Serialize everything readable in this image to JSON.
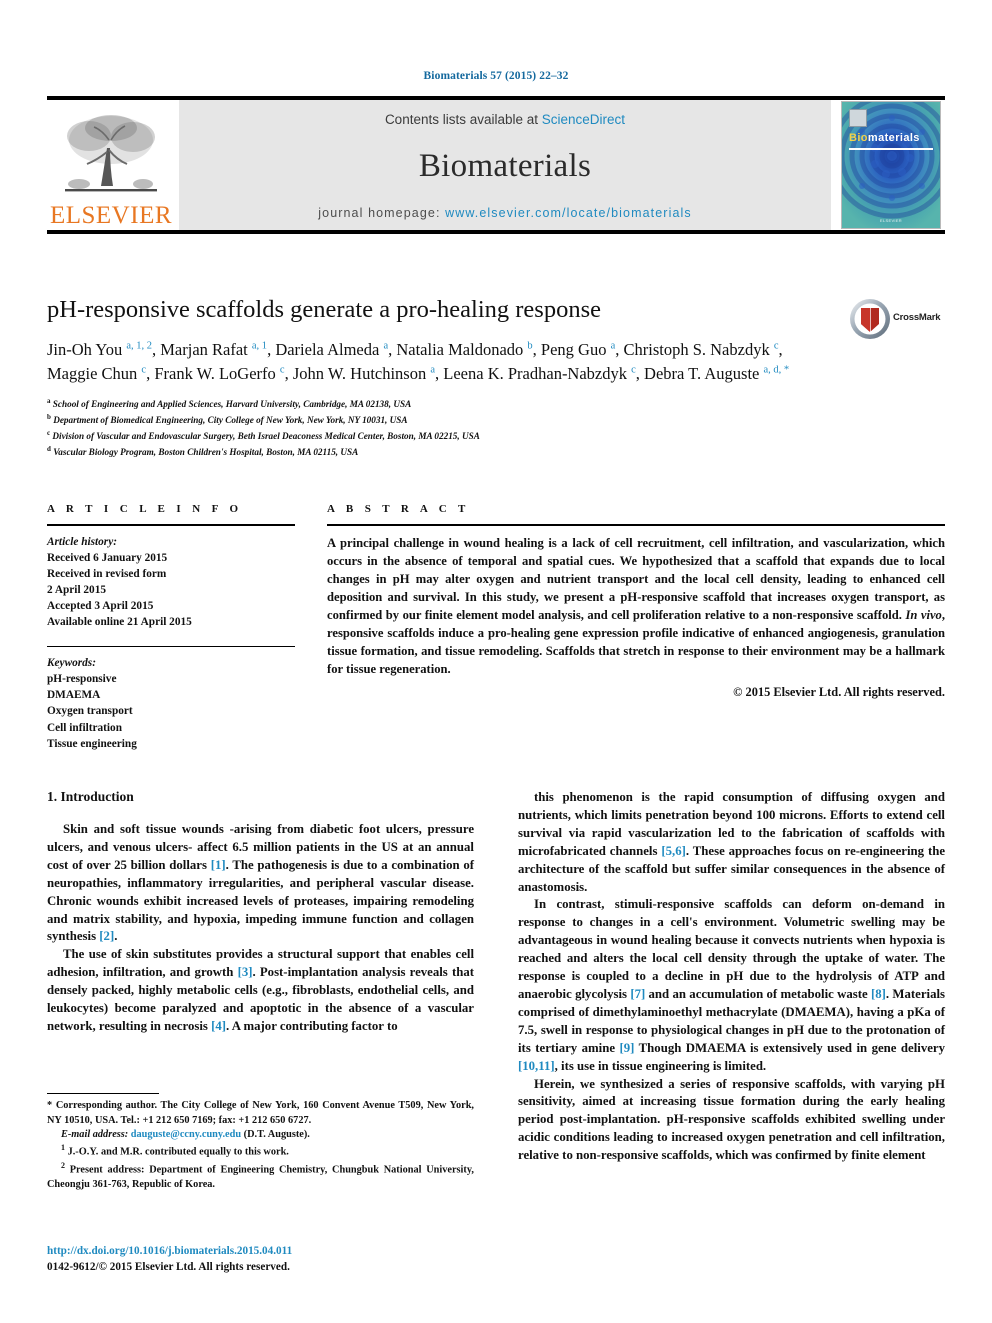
{
  "running_head": "Biomaterials 57 (2015) 22–32",
  "masthead": {
    "publisher_logo_text": "ELSEVIER",
    "contents_prefix": "Contents lists available at ",
    "contents_link": "ScienceDirect",
    "journal_name": "Biomaterials",
    "homepage_prefix": "journal homepage: ",
    "homepage_url": "www.elsevier.com/locate/biomaterials",
    "cover": {
      "title_bio": "Bio",
      "title_rest": "materials",
      "footer": "ELSEVIER"
    }
  },
  "article": {
    "title": "pH-responsive scaffolds generate a pro-healing response",
    "crossmark_label": "CrossMark",
    "authors_html": "Jin-Oh You <sup>a, 1, 2</sup>, Marjan Rafat <sup>a, 1</sup>, Dariela Almeda <sup>a</sup>, Natalia Maldonado <sup>b</sup>, Peng Guo <sup>a</sup>, Christoph S. Nabzdyk <sup>c</sup>, Maggie Chun <sup>c</sup>, Frank W. LoGerfo <sup>c</sup>, John W. Hutchinson <sup>a</sup>, Leena K. Pradhan-Nabzdyk <sup>c</sup>, Debra T. Auguste <sup>a, d, *</sup>",
    "affiliations": [
      {
        "mark": "a",
        "text": "School of Engineering and Applied Sciences, Harvard University, Cambridge, MA 02138, USA"
      },
      {
        "mark": "b",
        "text": "Department of Biomedical Engineering, City College of New York, New York, NY 10031, USA"
      },
      {
        "mark": "c",
        "text": "Division of Vascular and Endovascular Surgery, Beth Israel Deaconess Medical Center, Boston, MA 02215, USA"
      },
      {
        "mark": "d",
        "text": "Vascular Biology Program, Boston Children's Hospital, Boston, MA 02115, USA"
      }
    ]
  },
  "article_info": {
    "heading": "A R T I C L E  I N F O",
    "history_label": "Article history:",
    "history": [
      "Received 6 January 2015",
      "Received in revised form",
      "2 April 2015",
      "Accepted 3 April 2015",
      "Available online 21 April 2015"
    ],
    "keywords_label": "Keywords:",
    "keywords": [
      "pH-responsive",
      "DMAEMA",
      "Oxygen transport",
      "Cell infiltration",
      "Tissue engineering"
    ]
  },
  "abstract": {
    "heading": "A B S T R A C T",
    "text_html": "A principal challenge in wound healing is a lack of cell recruitment, cell infiltration, and vascularization, which occurs in the absence of temporal and spatial cues. We hypothesized that a scaffold that expands due to local changes in pH may alter oxygen and nutrient transport and the local cell density, leading to enhanced cell deposition and survival. In this study, we present a pH-responsive scaffold that increases oxygen transport, as confirmed by our finite element model analysis, and cell proliferation relative to a non-responsive scaffold. <i>In vivo</i>, responsive scaffolds induce a pro-healing gene expression profile indicative of enhanced angiogenesis, granulation tissue formation, and tissue remodeling. Scaffolds that stretch in response to their environment may be a hallmark for tissue regeneration.",
    "copyright": "© 2015 Elsevier Ltd. All rights reserved."
  },
  "body": {
    "section_heading": "1. Introduction",
    "left_paragraphs_html": [
      "Skin and soft tissue wounds -arising from diabetic foot ulcers, pressure ulcers, and venous ulcers- affect 6.5 million patients in the US at an annual cost of over 25 billion dollars <span class=\"ref\">[1]</span>. The pathogenesis is due to a combination of neuropathies, inflammatory irregularities, and peripheral vascular disease. Chronic wounds exhibit increased levels of proteases, impairing remodeling and matrix stability, and hypoxia, impeding immune function and collagen synthesis <span class=\"ref\">[2]</span>.",
      "The use of skin substitutes provides a structural support that enables cell adhesion, infiltration, and growth <span class=\"ref\">[3]</span>. Post-implantation analysis reveals that densely packed, highly metabolic cells (e.g., fibroblasts, endothelial cells, and leukocytes) become paralyzed and apoptotic in the absence of a vascular network, resulting in necrosis <span class=\"ref\">[4]</span>. A major contributing factor to"
    ],
    "right_paragraphs_html": [
      "this phenomenon is the rapid consumption of diffusing oxygen and nutrients, which limits penetration beyond 100 microns. Efforts to extend cell survival via rapid vascularization led to the fabrication of scaffolds with microfabricated channels <span class=\"ref\">[5,6]</span>. These approaches focus on re-engineering the architecture of the scaffold but suffer similar consequences in the absence of anastomosis.",
      "In contrast, stimuli-responsive scaffolds can deform on-demand in response to changes in a cell's environment. Volumetric swelling may be advantageous in wound healing because it convects nutrients when hypoxia is reached and alters the local cell density through the uptake of water. The response is coupled to a decline in pH due to the hydrolysis of ATP and anaerobic glycolysis <span class=\"ref\">[7]</span> and an accumulation of metabolic waste <span class=\"ref\">[8]</span>. Materials comprised of dimethylaminoethyl methacrylate (DMAEMA), having a pKa of 7.5, swell in response to physiological changes in pH due to the protonation of its tertiary amine <span class=\"ref\">[9]</span> Though DMAEMA is extensively used in gene delivery <span class=\"ref\">[10,11]</span>, its use in tissue engineering is limited.",
      "Herein, we synthesized a series of responsive scaffolds, with varying pH sensitivity, aimed at increasing tissue formation during the early healing period post-implantation. pH-responsive scaffolds exhibited swelling under acidic conditions leading to increased oxygen penetration and cell infiltration, relative to non-responsive scaffolds, which was confirmed by finite element"
    ]
  },
  "footnotes": {
    "corresponding_html": "* Corresponding author. The City College of New York, 160 Convent Avenue T509, New York, NY 10510, USA. Tel.: +1 212 650 7169; fax: +1 212 650 6727.",
    "email_label": "E-mail address:",
    "email": "dauguste@ccny.cuny.edu",
    "email_suffix": "(D.T. Auguste).",
    "note1_mark": "1",
    "note1": "J.-O.Y. and M.R. contributed equally to this work.",
    "note2_mark": "2",
    "note2": "Present address: Department of Engineering Chemistry, Chungbuk National University, Cheongju 361-763, Republic of Korea."
  },
  "doi_block": {
    "doi_url": "http://dx.doi.org/10.1016/j.biomaterials.2015.04.011",
    "issn_line": "0142-9612/© 2015 Elsevier Ltd. All rights reserved."
  },
  "colors": {
    "link": "#1f8ac0",
    "running_head": "#14699e",
    "elsevier_orange": "#E87722",
    "masthead_bg": "#e6e6e6"
  }
}
